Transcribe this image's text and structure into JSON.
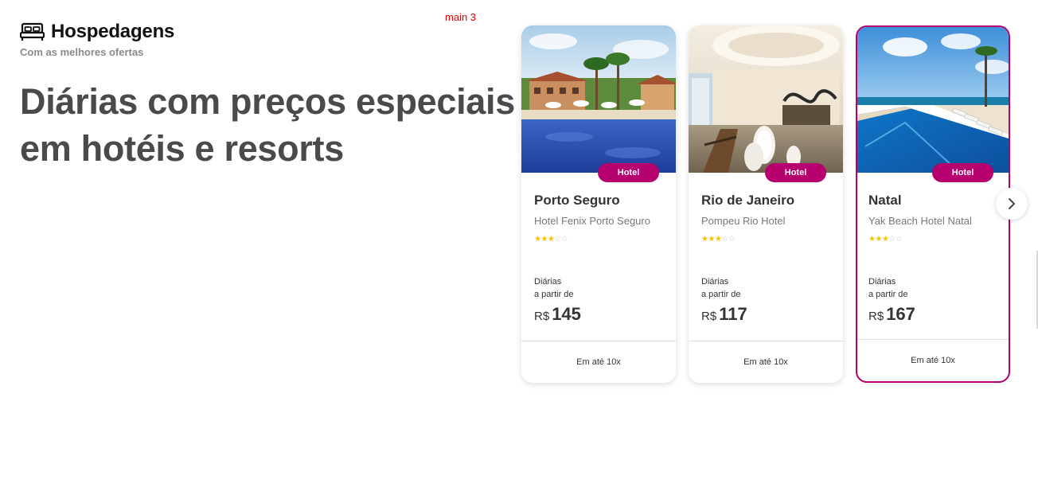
{
  "debug": {
    "label": "main 3"
  },
  "header": {
    "icon": "bed-icon",
    "title": "Hospedagens",
    "subtitle": "Com as melhores ofertas"
  },
  "headline": {
    "line1": "Diárias com preços especiais",
    "line2": "em hotéis e resorts"
  },
  "colors": {
    "accent": "#b5006e",
    "star": "#f2c200",
    "headline": "#4a4a4a"
  },
  "cards": [
    {
      "badge": "Hotel",
      "city": "Porto Seguro",
      "hotel": "Hotel Fenix Porto Seguro",
      "stars_filled": 3,
      "stars_total": 5,
      "price_caption_1": "Diárias",
      "price_caption_2": "a partir de",
      "currency": "R$",
      "price": "145",
      "installments": "Em até 10x"
    },
    {
      "badge": "Hotel",
      "city": "Rio de Janeiro",
      "hotel": "Pompeu Rio Hotel",
      "stars_filled": 3,
      "stars_total": 5,
      "price_caption_1": "Diárias",
      "price_caption_2": "a partir de",
      "currency": "R$",
      "price": "117",
      "installments": "Em até 10x"
    },
    {
      "badge": "Hotel",
      "city": "Natal",
      "hotel": "Yak Beach Hotel Natal",
      "stars_filled": 3,
      "stars_total": 5,
      "price_caption_1": "Diárias",
      "price_caption_2": "a partir de",
      "currency": "R$",
      "price": "167",
      "installments": "Em até 10x"
    }
  ],
  "carousel": {
    "next_icon": "chevron-right-icon"
  }
}
